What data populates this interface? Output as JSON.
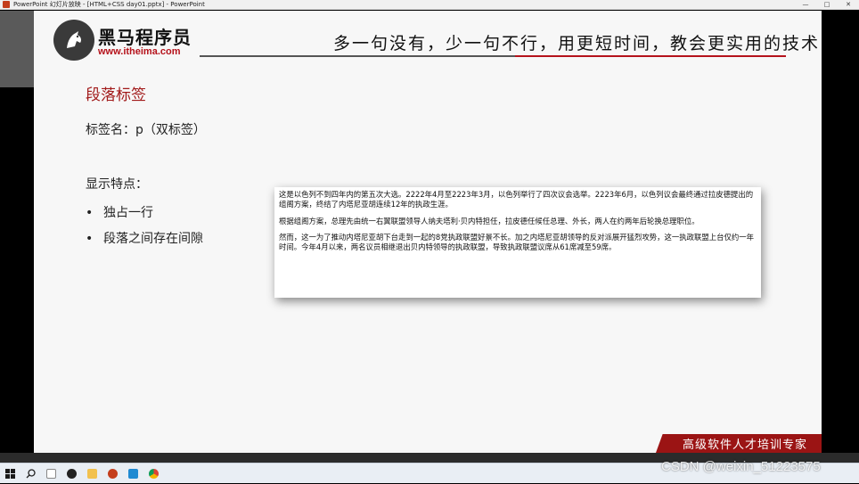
{
  "window": {
    "title": "PowerPoint 幻灯片放映 - [HTML+CSS day01.pptx] - PowerPoint",
    "controls": [
      "—",
      "□",
      "✕"
    ]
  },
  "slide": {
    "logo_name": "黑马程序员",
    "logo_url": "www.itheima.com",
    "slogan": "多一句没有，少一句不行，用更短时间，教会更实用的技术!",
    "title": "段落标签",
    "tag_line": "标签名：p（双标签）",
    "features_title": "显示特点：",
    "bullets": [
      "独占一行",
      "段落之间存在间隙"
    ],
    "banner": "高级软件人才培训专家"
  },
  "popup": {
    "paragraphs": [
      "这是以色列不到四年内的第五次大选。2222年4月至2223年3月，以色列举行了四次议会选举。2223年6月，以色列议会最终通过拉皮德提出的组阁方案，终结了内塔尼亚胡连续12年的执政生涯。",
      "根据组阁方案，总理先由统一右翼联盟领导人纳夫塔利·贝内特担任，拉皮德任候任总理、外长，两人在约两年后轮换总理职位。",
      "然而，这一为了推动内塔尼亚胡下台走到一起的8党执政联盟好景不长。加之内塔尼亚胡领导的反对派展开猛烈攻势，这一执政联盟上台仅约一年时间。今年4月以来，两名议员相继退出贝内特领导的执政联盟，导致执政联盟议席从61席减至59席。"
    ]
  },
  "taskbar": {
    "watermark": "CSDN @weixin_51223575",
    "icons": [
      "windows-start-icon",
      "search-icon",
      "typora-icon",
      "github-icon",
      "file-explorer-icon",
      "powerpoint-icon",
      "vscode-icon",
      "chrome-icon"
    ]
  },
  "colors": {
    "accent_red": "#b5121b",
    "title_red": "#a11a1a"
  }
}
